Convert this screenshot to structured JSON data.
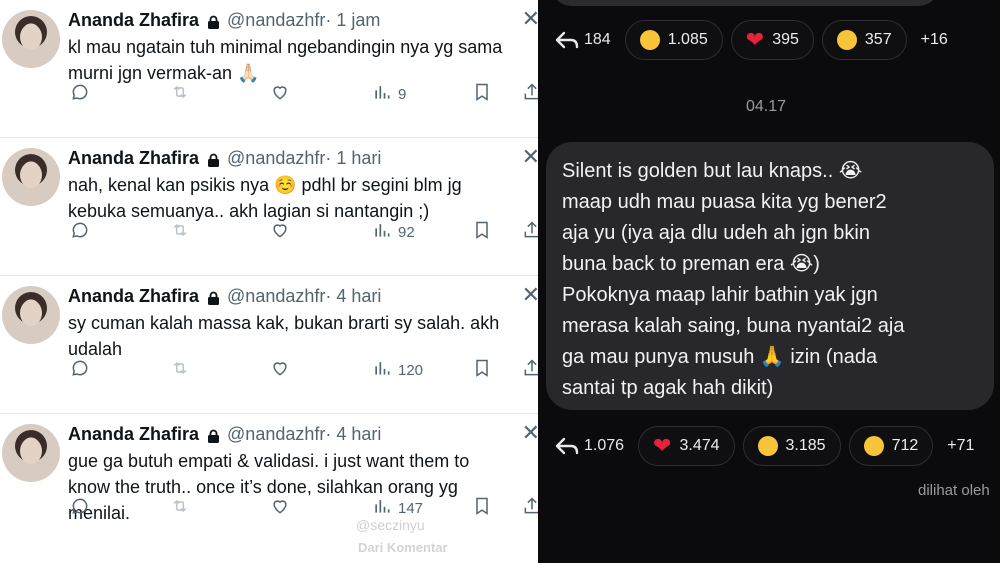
{
  "tweets": [
    {
      "name": "Ananda Zhafira",
      "handle": "@nandazhfr",
      "time": "· 1 jam",
      "lines": [
        "kl mau ngatain tuh minimal ngebandingin nya yg sama",
        "murni jgn vermak-an 🙏🏻"
      ],
      "views": "9"
    },
    {
      "name": "Ananda Zhafira",
      "handle": "@nandazhfr",
      "time": "· 1 hari",
      "lines": [
        "nah, kenal kan psikis nya ☺️ pdhl br segini blm jg",
        "kebuka semuanya.. akh lagian si nantangin ;)"
      ],
      "views": "92"
    },
    {
      "name": "Ananda Zhafira",
      "handle": "@nandazhfr",
      "time": "· 4 hari",
      "lines": [
        "sy cuman kalah massa kak, bukan brarti sy salah. akh",
        "udalah"
      ],
      "views": "120"
    },
    {
      "name": "Ananda Zhafira",
      "handle": "@nandazhfr",
      "time": "· 4 hari",
      "lines": [
        "gue ga butuh empati & validasi. i just want them to",
        "know the truth.. once it’s done, silahkan orang yg",
        "menilai."
      ],
      "views": "147"
    }
  ],
  "watermark": "@seczinyu",
  "watermark2": "Dari Komentar",
  "chat": {
    "top_reactions": {
      "replies": "184",
      "items": [
        {
          "icon": "joy-emoji",
          "count": "1.085"
        },
        {
          "icon": "heart",
          "count": "395"
        },
        {
          "icon": "rofl-emoji",
          "count": "357"
        }
      ],
      "more": "+16"
    },
    "timestamp": "04.17",
    "message_lines": [
      "Silent is golden but lau knaps.. 😭",
      "maap udh mau puasa kita yg bener2",
      "aja yu (iya aja dlu udeh ah jgn bkin",
      "buna back to preman era 😭)",
      "Pokoknya maap lahir bathin yak jgn",
      "merasa kalah saing, buna nyantai2 aja",
      "ga mau punya musuh 🙏 izin (nada",
      "santai tp agak hah dikit)"
    ],
    "bottom_reactions": {
      "replies": "1.076",
      "items": [
        {
          "icon": "heart",
          "count": "3.474"
        },
        {
          "icon": "joy-emoji",
          "count": "3.185"
        },
        {
          "icon": "sweat-smile-emoji",
          "count": "712"
        }
      ],
      "more": "+71"
    },
    "seen_by": "dilihat oleh"
  },
  "colors": {
    "heart": "#e8213a",
    "emoji": "#f7c43a",
    "bubble": "#28282c",
    "handle": "#536471"
  }
}
